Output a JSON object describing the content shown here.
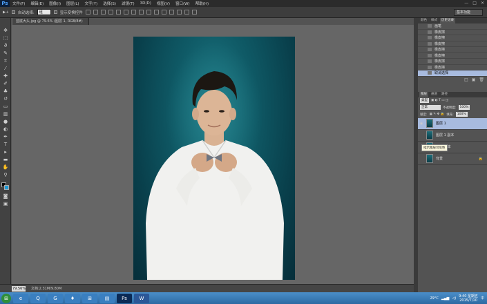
{
  "app": {
    "logo": "Ps"
  },
  "menu": [
    "文件(F)",
    "编辑(E)",
    "图像(I)",
    "图层(L)",
    "文字(Y)",
    "选择(S)",
    "滤镜(T)",
    "3D(D)",
    "视图(V)",
    "窗口(W)",
    "帮助(H)"
  ],
  "window_controls": [
    "—",
    "□",
    "✕"
  ],
  "options": {
    "auto_select_label": "自动选择:",
    "auto_select_value": "组",
    "transform_label": "显示变换控件",
    "workspace": "基本功能"
  },
  "document": {
    "tab_title": "蓝底大头.jpg @ 79.6% (图层 1, RGB/8#)"
  },
  "status": {
    "zoom": "79.56%",
    "doc_size": "文档:2.31M/9.80M"
  },
  "history": {
    "tabs": [
      "颜色",
      "样式",
      "历史记录"
    ],
    "items": [
      "画笔",
      "橡皮擦",
      "橡皮擦",
      "橡皮擦",
      "橡皮擦",
      "橡皮擦",
      "橡皮擦",
      "橡皮擦",
      "取消选择"
    ]
  },
  "layers": {
    "tabs": [
      "图层",
      "通道",
      "路径"
    ],
    "kind_filter": "类型",
    "blend_mode": "正常",
    "opacity_label": "不透明度:",
    "opacity": "100%",
    "lock_label": "锁定:",
    "fill_label": "填充:",
    "fill": "100%",
    "items": [
      {
        "name": "图层 1",
        "selected": true
      },
      {
        "name": "图层 1 副本",
        "selected": false
      },
      {
        "name": "背景 副本",
        "selected": false
      },
      {
        "name": "背景",
        "selected": false
      }
    ],
    "tooltip": "指示图层可见性"
  },
  "taskbar": {
    "apps": [
      "e",
      "Q",
      "G",
      "♦",
      "⊞",
      "▤",
      "Ps",
      "W"
    ],
    "weather": "29°C",
    "time": "9:40 星期五",
    "date": "2015/7/10",
    "lang": "中"
  },
  "colors": {
    "accent_selected": "#a8bbdf",
    "canvas_bg": "#0f5a66",
    "taskbar": "#2d6aa3"
  }
}
